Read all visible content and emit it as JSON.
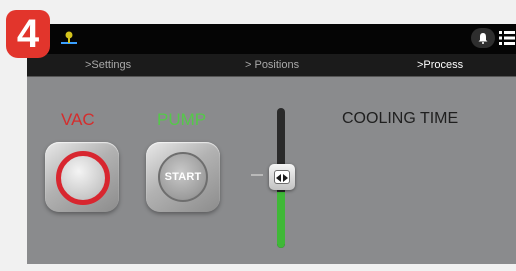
{
  "step_badge": "4",
  "topbar": {
    "location_icon": "location-pin-icon",
    "notification_icon": "bell-icon",
    "menu_icon": "menu-list-icon"
  },
  "tabs": [
    {
      "label": ">Settings",
      "active": false
    },
    {
      "label": "> Positions",
      "active": false
    },
    {
      "label": ">Process",
      "active": true
    }
  ],
  "controls": {
    "vac": {
      "label": "VAC",
      "color": "#d42d2d",
      "icon": "vacuum-ring-icon"
    },
    "pump": {
      "label": "PUMP",
      "color": "#55c84a",
      "button_text": "START"
    },
    "cooling_time": {
      "label": "COOLING TIME",
      "slider_fill_fraction": 0.4,
      "fill_color": "#3fb837"
    }
  }
}
